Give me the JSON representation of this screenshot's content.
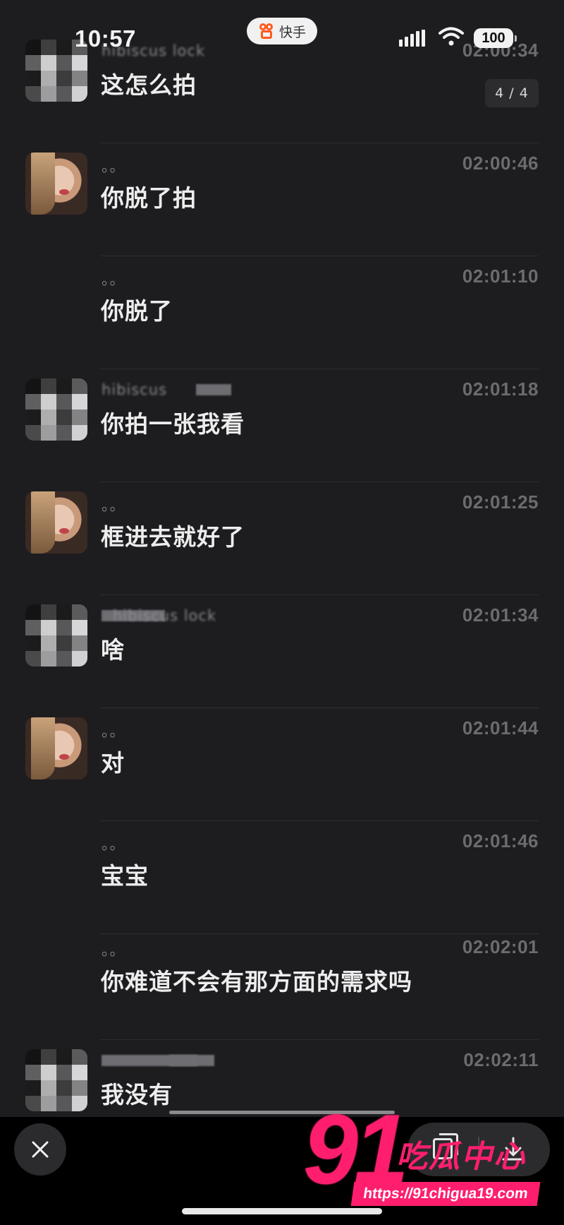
{
  "status_bar": {
    "time": "10:57",
    "app_name": "快手",
    "battery": "100"
  },
  "page_counter": "4 / 4",
  "messages": [
    {
      "avatar": "pixelated",
      "name": "hibiscus lock",
      "time": "02:00:34",
      "text": "这怎么拍"
    },
    {
      "avatar": "photo",
      "name": "。。",
      "time": "02:00:46",
      "text": "你脱了拍"
    },
    {
      "avatar": "none",
      "name": "。。",
      "time": "02:01:10",
      "text": "你脱了"
    },
    {
      "avatar": "pixelated",
      "name": "hibiscus",
      "time": "02:01:18",
      "text": "你拍一张我看"
    },
    {
      "avatar": "photo",
      "name": "。。",
      "time": "02:01:25",
      "text": "框进去就好了"
    },
    {
      "avatar": "pixelated",
      "name": "hibiscus lock",
      "time": "02:01:34",
      "text": "啥"
    },
    {
      "avatar": "photo",
      "name": "。。",
      "time": "02:01:44",
      "text": "对"
    },
    {
      "avatar": "none",
      "name": "。。",
      "time": "02:01:46",
      "text": "宝宝"
    },
    {
      "avatar": "none",
      "name": "。。",
      "time": "02:02:01",
      "text": "你难道不会有那方面的需求吗"
    },
    {
      "avatar": "pixelated",
      "name": "",
      "time": "02:02:11",
      "text": "我没有"
    }
  ],
  "watermark": {
    "number": "91",
    "label": "吃瓜中心",
    "url": "https://91chigua19.com"
  },
  "icons": {
    "close": "close-icon",
    "copy": "copy-icon",
    "download": "download-icon"
  }
}
